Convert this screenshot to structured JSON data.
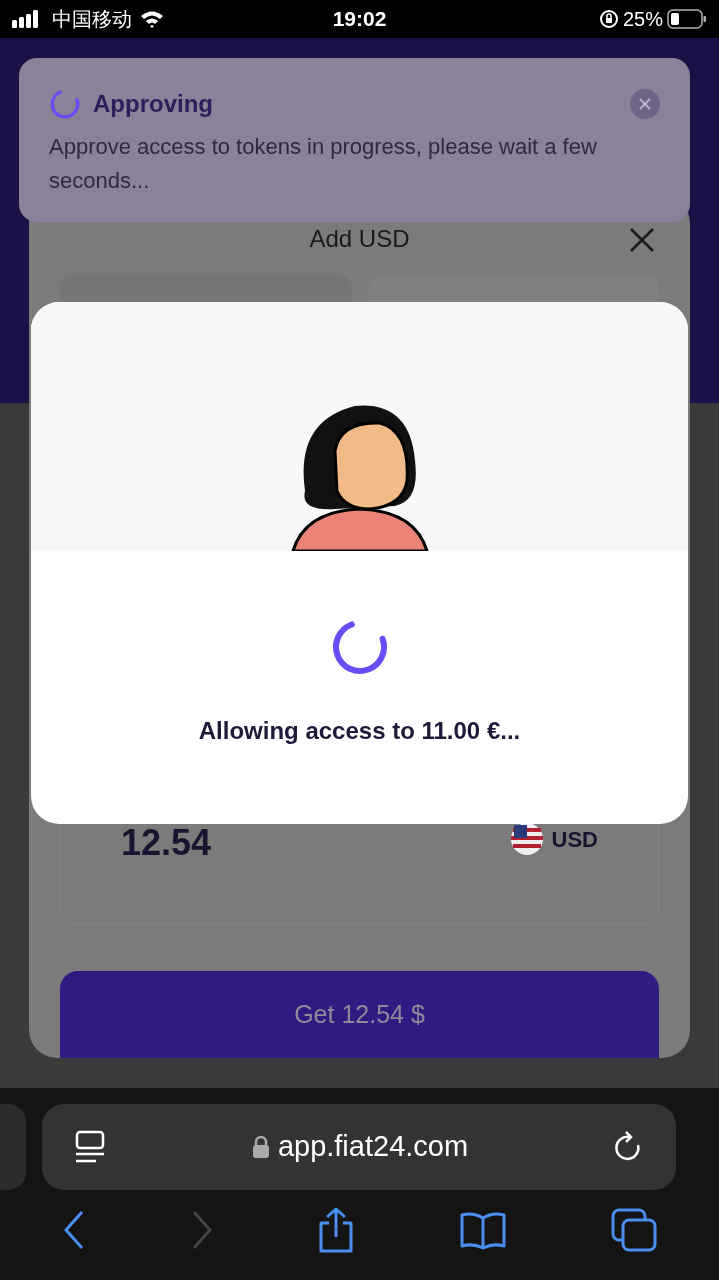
{
  "status_bar": {
    "carrier": "中国移动",
    "time": "19:02",
    "battery": "25%"
  },
  "toast": {
    "title": "Approving",
    "message": "Approve access to tokens in progress, please wait a few seconds..."
  },
  "sheet": {
    "title": "Add USD",
    "amount": "12.54",
    "currency": "USD",
    "button": "Get 12.54 $"
  },
  "modal": {
    "message": "Allowing access to 11.00 €..."
  },
  "browser": {
    "url": "app.fiat24.com",
    "forward_disabled": true
  }
}
